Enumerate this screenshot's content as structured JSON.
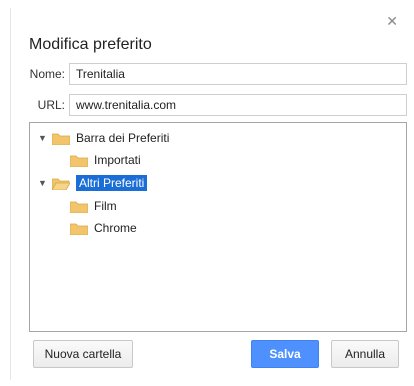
{
  "dialog": {
    "title": "Modifica preferito",
    "close_icon": "close-icon"
  },
  "fields": {
    "name_label": "Nome:",
    "name_value": "Trenitalia",
    "url_label": "URL:",
    "url_value": "www.trenitalia.com"
  },
  "tree": {
    "items": [
      {
        "label": "Barra dei Preferiti",
        "expanded": true,
        "selected": false
      },
      {
        "label": "Importati",
        "selected": false
      },
      {
        "label": "Altri Preferiti",
        "expanded": true,
        "selected": true
      },
      {
        "label": "Film",
        "selected": false
      },
      {
        "label": "Chrome",
        "selected": false
      }
    ]
  },
  "buttons": {
    "new_folder": "Nuova cartella",
    "save": "Salva",
    "cancel": "Annulla"
  },
  "colors": {
    "selection": "#1b6ed6",
    "primary_button": "#4d90fe",
    "folder": "#f2c56c"
  }
}
